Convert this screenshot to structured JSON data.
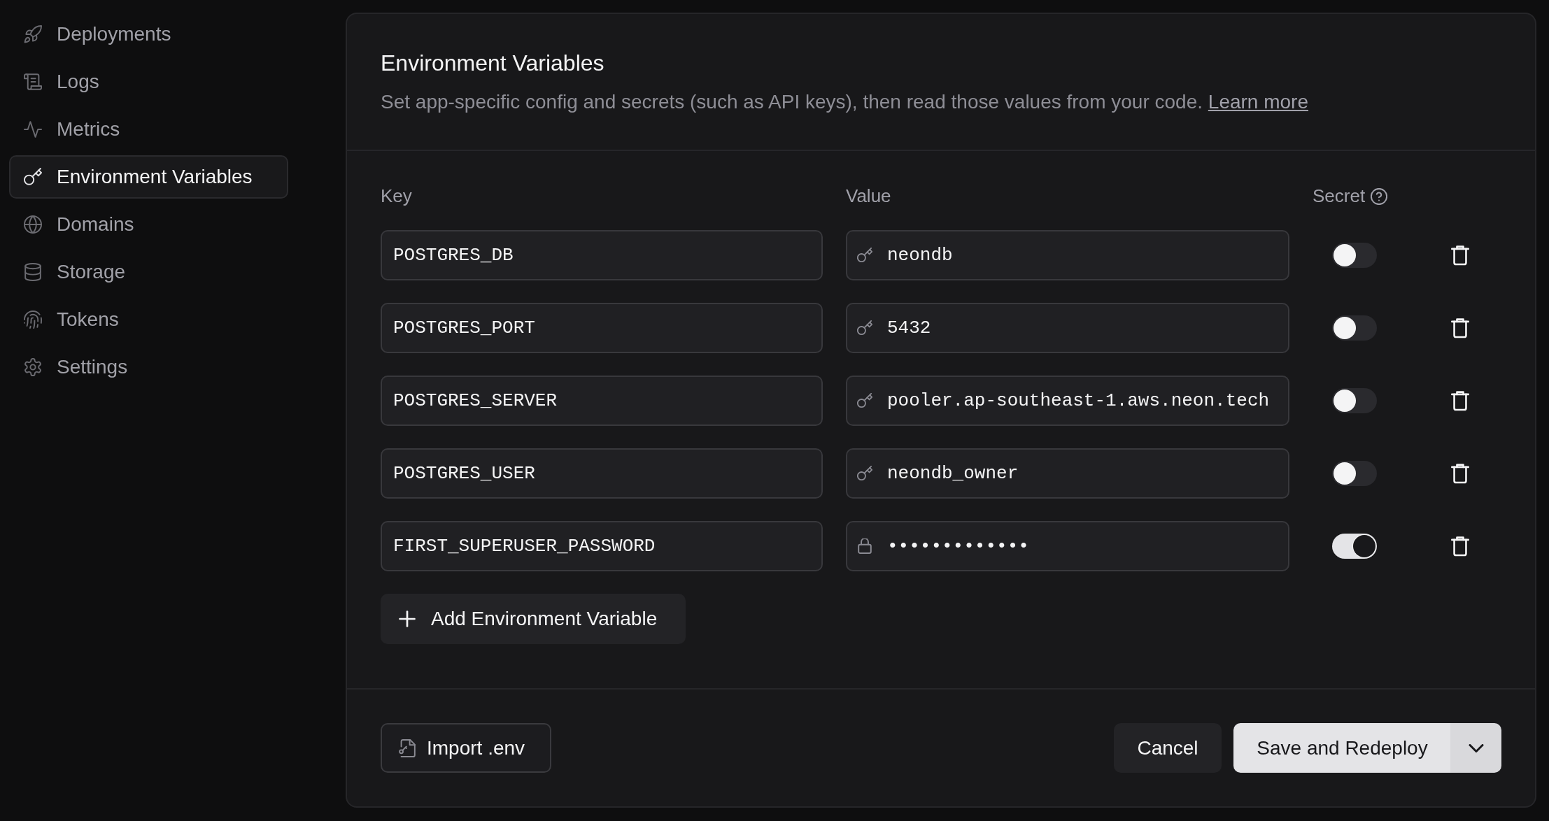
{
  "sidebar": {
    "items": [
      {
        "label": "Deployments",
        "selected": false
      },
      {
        "label": "Logs",
        "selected": false
      },
      {
        "label": "Metrics",
        "selected": false
      },
      {
        "label": "Environment Variables",
        "selected": true
      },
      {
        "label": "Domains",
        "selected": false
      },
      {
        "label": "Storage",
        "selected": false
      },
      {
        "label": "Tokens",
        "selected": false
      },
      {
        "label": "Settings",
        "selected": false
      }
    ]
  },
  "panel": {
    "title": "Environment Variables",
    "description": "Set app-specific config and secrets (such as API keys), then read those values from your code.",
    "link": "Learn more",
    "columns": [
      "Key",
      "Value",
      "Secret"
    ],
    "variables": [
      {
        "key": "POSTGRES_DB",
        "value": "neondb",
        "secret": false
      },
      {
        "key": "POSTGRES_PORT",
        "value": "5432",
        "secret": false
      },
      {
        "key": "POSTGRES_SERVER",
        "value": "pooler.ap-southeast-1.aws.neon.tech",
        "secret": false
      },
      {
        "key": "POSTGRES_USER",
        "value": "neondb_owner",
        "secret": false
      },
      {
        "key": "FIRST_SUPERUSER_PASSWORD",
        "value": "•••••••••••••",
        "secret": true
      }
    ],
    "add_button": "Add Environment Variable"
  },
  "footer": {
    "import_button": "Import .env",
    "cancel_button": "Cancel",
    "save_button": "Save and Redeploy"
  }
}
